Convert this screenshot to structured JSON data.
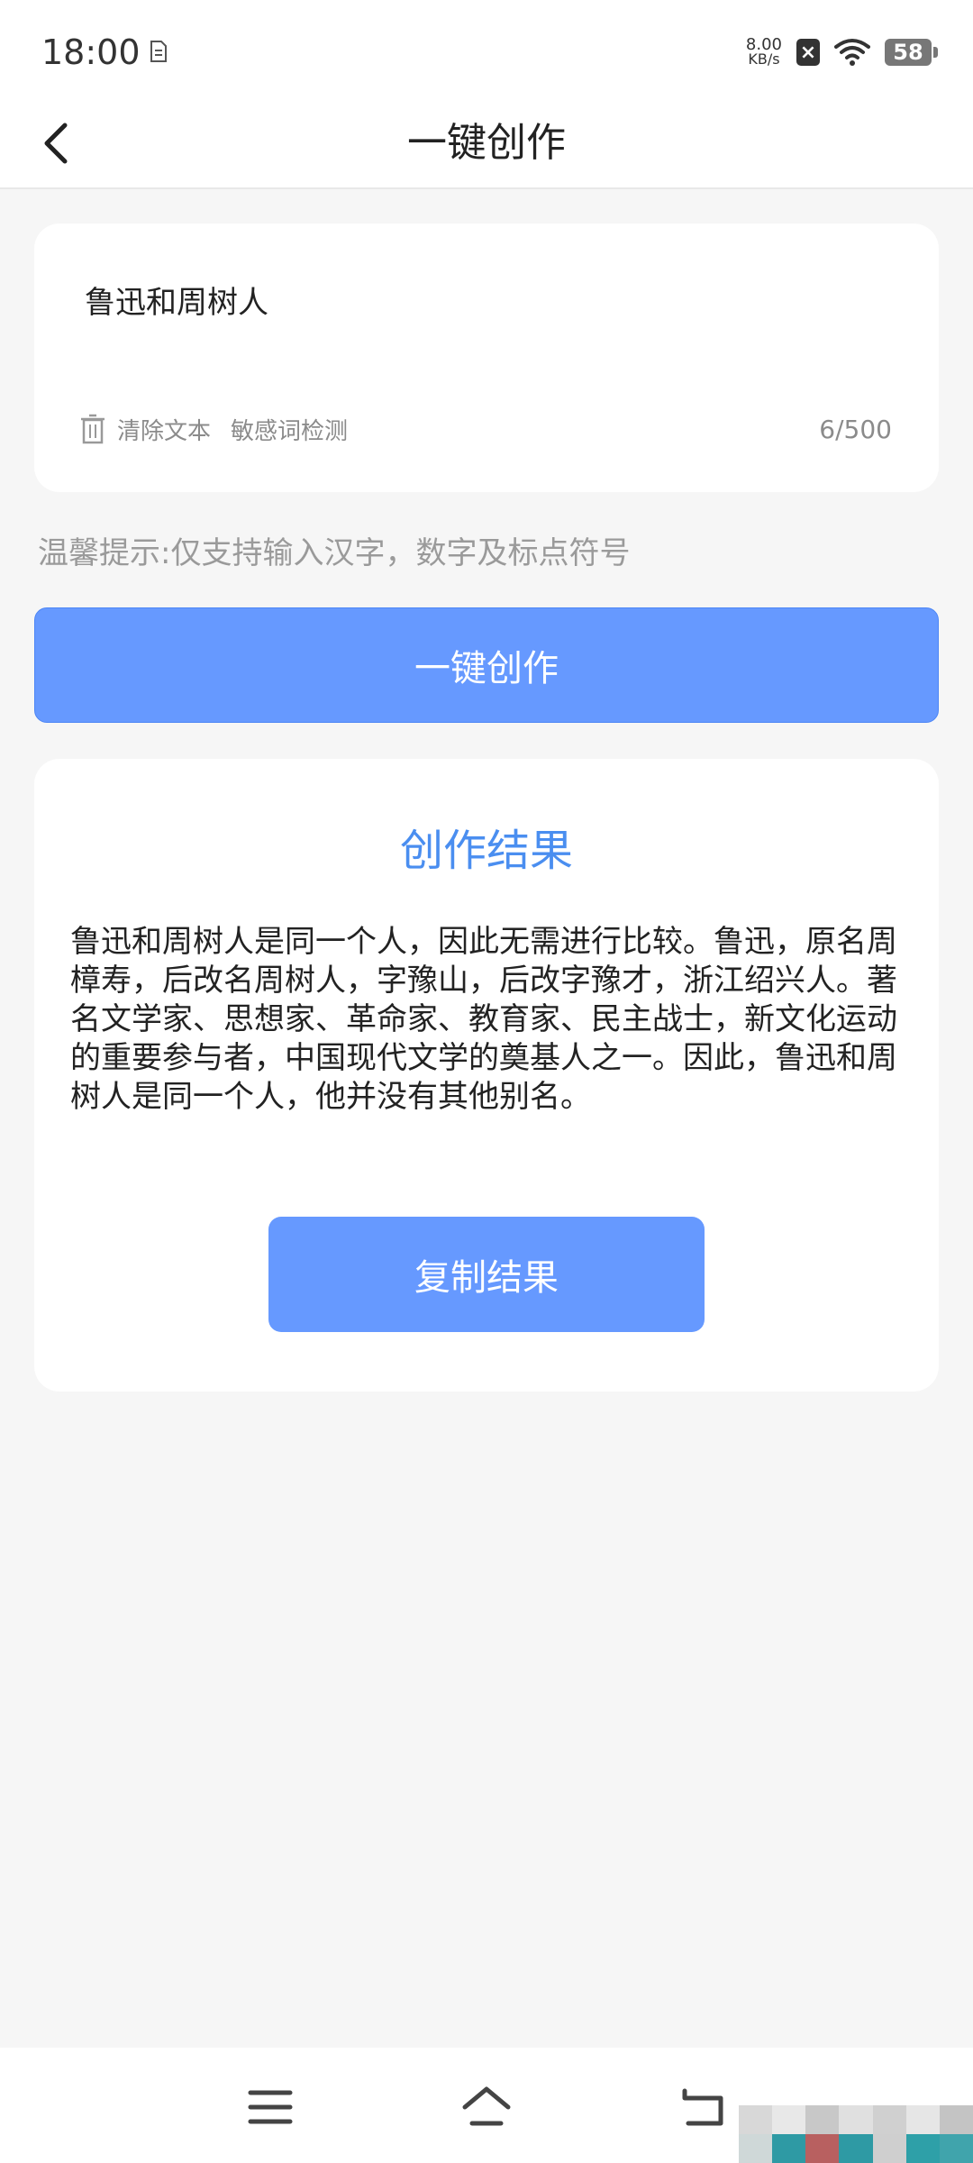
{
  "status_bar": {
    "time": "18:00",
    "net_speed_value": "8.00",
    "net_speed_unit": "KB/s",
    "battery": "58"
  },
  "header": {
    "title": "一键创作"
  },
  "input_card": {
    "text": "鲁迅和周树人",
    "clear_label": "清除文本",
    "sensitive_label": "敏感词检测",
    "char_count": "6/500"
  },
  "tip": "温馨提示:仅支持输入汉字，数字及标点符号",
  "create_button_label": "一键创作",
  "result": {
    "title": "创作结果",
    "text": "鲁迅和周树人是同一个人，因此无需进行比较。鲁迅，原名周樟寿，后改名周树人，字豫山，后改字豫才，浙江绍兴人。著名文学家、思想家、革命家、教育家、民主战士，新文化运动的重要参与者，中国现代文学的奠基人之一。因此，鲁迅和周树人是同一个人，他并没有其他别名。",
    "copy_label": "复制结果"
  },
  "colors": {
    "accent": "#6699ff",
    "result_title": "#4a8ef0"
  }
}
